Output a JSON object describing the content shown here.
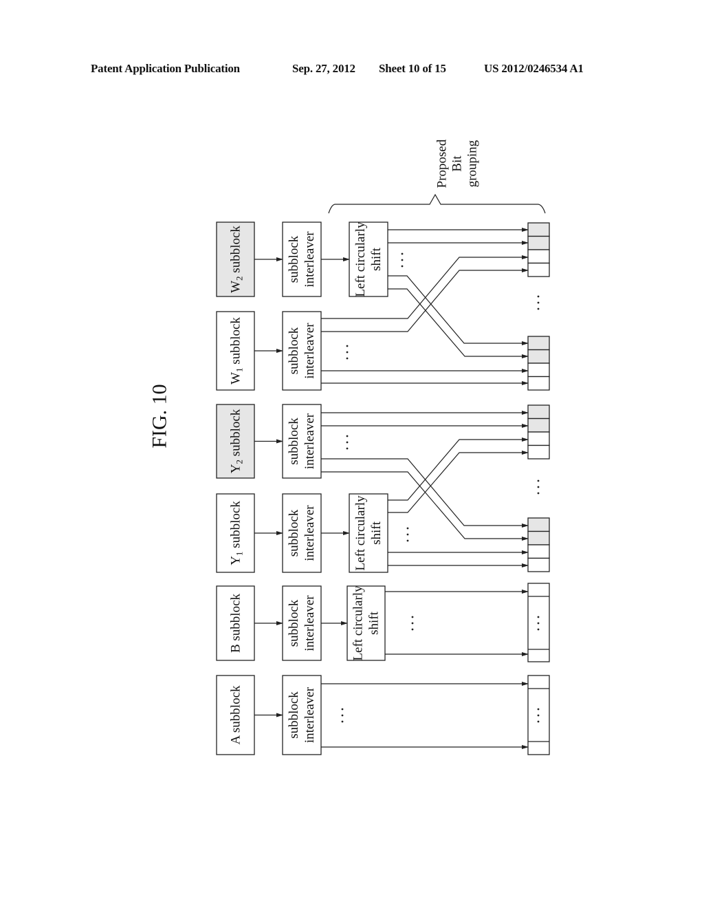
{
  "header": {
    "publication": "Patent Application Publication",
    "date": "Sep. 27, 2012",
    "sheet": "Sheet 10 of 15",
    "number": "US 2012/0246534 A1"
  },
  "figure": {
    "title": "FIG. 10",
    "bracket_label": [
      "Proposed",
      "Bit",
      "grouping"
    ],
    "ellipsis": "· · ·",
    "rows": [
      {
        "id": "w2",
        "subblock": [
          "W",
          "2",
          " subblock"
        ],
        "shaded": true,
        "interleaver": [
          "subblock",
          "interleaver"
        ],
        "shift": [
          "Left circularly",
          "shift"
        ]
      },
      {
        "id": "w1",
        "subblock": [
          "W",
          "1",
          " subblock"
        ],
        "shaded": false,
        "interleaver": [
          "subblock",
          "interleaver"
        ],
        "shift": null
      },
      {
        "id": "y2",
        "subblock": [
          "Y",
          "2",
          " subblock"
        ],
        "shaded": true,
        "interleaver": [
          "subblock",
          "interleaver"
        ],
        "shift": null
      },
      {
        "id": "y1",
        "subblock": [
          "Y",
          "1",
          " subblock"
        ],
        "shaded": false,
        "interleaver": [
          "subblock",
          "interleaver"
        ],
        "shift": [
          "Left circularly",
          "shift"
        ]
      },
      {
        "id": "b",
        "subblock": [
          "B subblock",
          "",
          ""
        ],
        "shaded": false,
        "interleaver": [
          "subblock",
          "interleaver"
        ],
        "shift": [
          "Left circularly",
          "shift"
        ]
      },
      {
        "id": "a",
        "subblock": [
          "A subblock",
          "",
          ""
        ],
        "shaded": false,
        "interleaver": [
          "subblock",
          "interleaver"
        ],
        "shift": null
      }
    ]
  }
}
